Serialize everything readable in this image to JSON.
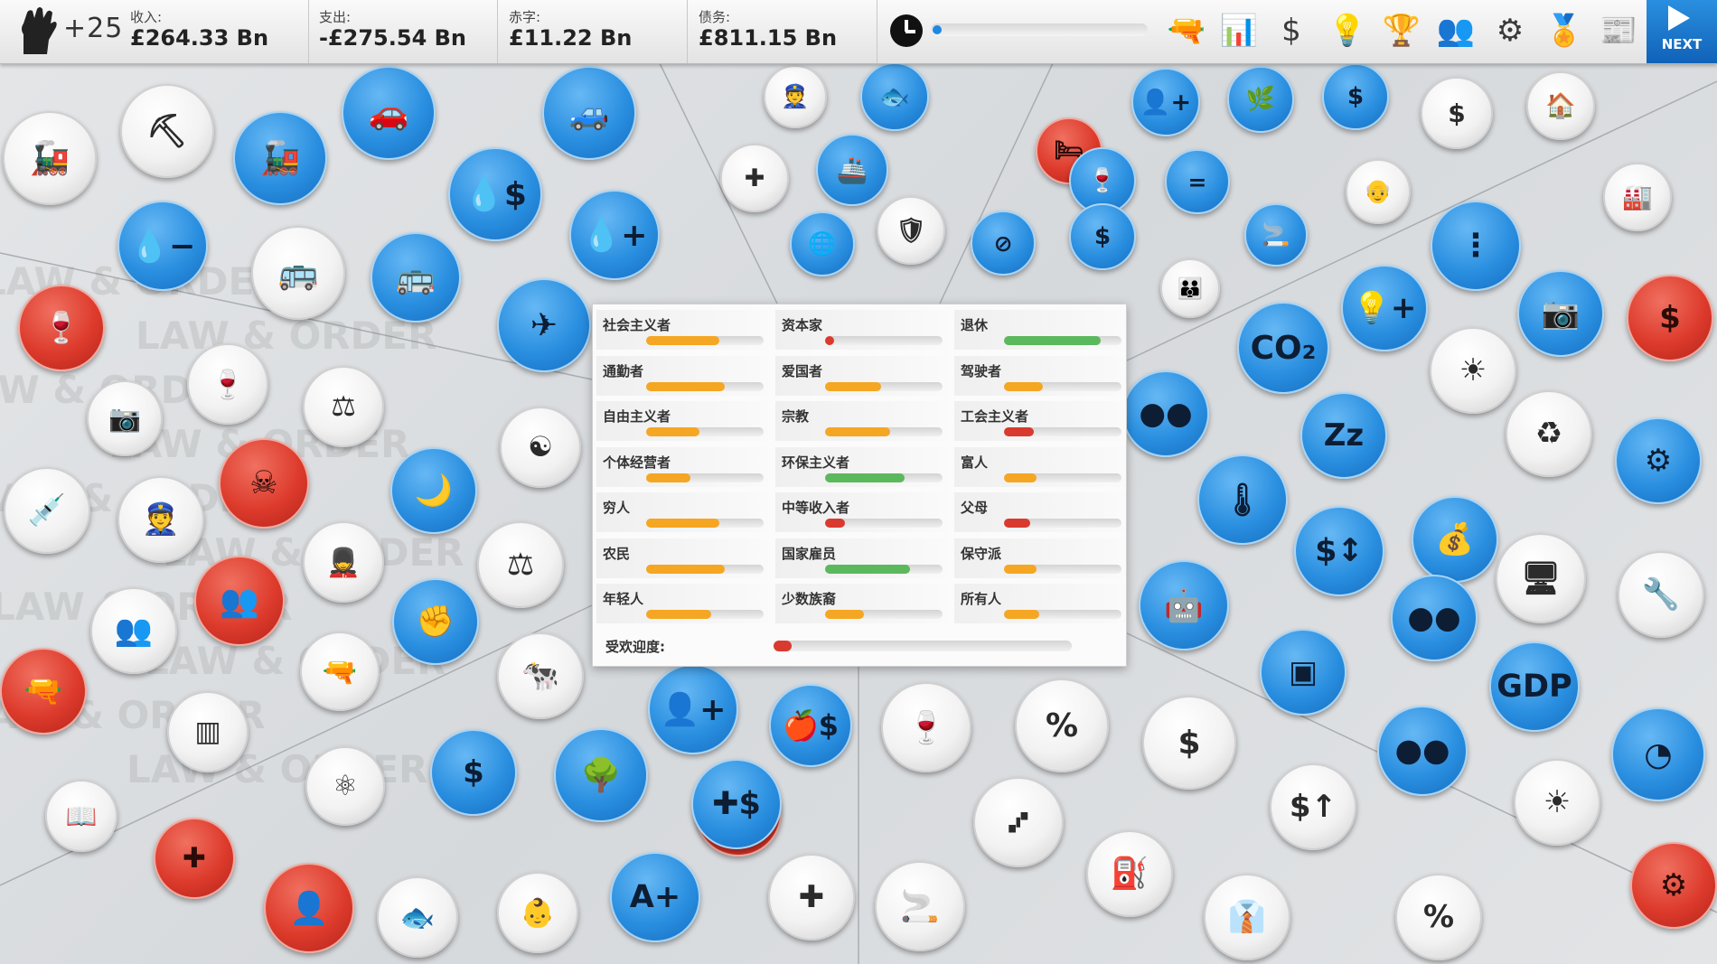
{
  "topbar": {
    "political_capital": "+25",
    "income_label": "收入:",
    "income_value": "£264.33 Bn",
    "expenses_label": "支出:",
    "expenses_value": "-£275.54 Bn",
    "deficit_label": "赤字:",
    "deficit_value": "£11.22 Bn",
    "debt_label": "债务:",
    "debt_value": "£811.15 Bn",
    "turn_progress": 0.02,
    "next_label": "NEXT"
  },
  "toolbar_icons": [
    "gun-icon",
    "bar-chart-icon",
    "dollar-icon",
    "lightbulb-icon",
    "trophy-icon",
    "people-icon",
    "gears-icon",
    "medal-icon",
    "newspaper-icon"
  ],
  "background_text": "LAW & ORDER",
  "voters": {
    "col1": [
      {
        "label": "社会主义者",
        "value": 0.62,
        "color": "#f5a623"
      },
      {
        "label": "通勤者",
        "value": 0.67,
        "color": "#f5a623"
      },
      {
        "label": "自由主义者",
        "value": 0.45,
        "color": "#f5a623"
      },
      {
        "label": "个体经营者",
        "value": 0.38,
        "color": "#f5a623"
      },
      {
        "label": "穷人",
        "value": 0.62,
        "color": "#f5a623"
      },
      {
        "label": "农民",
        "value": 0.67,
        "color": "#f5a623"
      },
      {
        "label": "年轻人",
        "value": 0.55,
        "color": "#f5a623"
      }
    ],
    "col2": [
      {
        "label": "资本家",
        "value": 0.08,
        "color": "#d93a2f"
      },
      {
        "label": "爱国者",
        "value": 0.48,
        "color": "#f5a623"
      },
      {
        "label": "宗教",
        "value": 0.55,
        "color": "#f5a623"
      },
      {
        "label": "环保主义者",
        "value": 0.68,
        "color": "#5cb85c"
      },
      {
        "label": "中等收入者",
        "value": 0.17,
        "color": "#d93a2f"
      },
      {
        "label": "国家雇员",
        "value": 0.72,
        "color": "#5cb85c"
      },
      {
        "label": "少数族裔",
        "value": 0.33,
        "color": "#f5a623"
      }
    ],
    "col3": [
      {
        "label": "退休",
        "value": 0.82,
        "color": "#5cb85c"
      },
      {
        "label": "驾驶者",
        "value": 0.33,
        "color": "#f5a623"
      },
      {
        "label": "工会主义者",
        "value": 0.25,
        "color": "#d93a2f"
      },
      {
        "label": "富人",
        "value": 0.28,
        "color": "#f5a623"
      },
      {
        "label": "父母",
        "value": 0.22,
        "color": "#d93a2f"
      },
      {
        "label": "保守派",
        "value": 0.28,
        "color": "#f5a623"
      },
      {
        "label": "所有人",
        "value": 0.3,
        "color": "#f5a623"
      }
    ],
    "popularity_label": "受欢迎度:",
    "popularity_value": 0.06
  },
  "policy_icons": [
    {
      "name": "rail-subsidies-icon",
      "style": "w",
      "glyph": "🚂"
    },
    {
      "name": "road-building-icon",
      "style": "w",
      "glyph": "⛏"
    },
    {
      "name": "rail-network-icon",
      "style": "b",
      "glyph": "🚂"
    },
    {
      "name": "car-tax-icon",
      "style": "b",
      "glyph": "🚗"
    },
    {
      "name": "car-emissions-icon",
      "style": "b",
      "glyph": "🚙"
    },
    {
      "name": "petrol-tax-icon",
      "style": "b",
      "glyph": "💧$"
    },
    {
      "name": "water-decrease-icon",
      "style": "b",
      "glyph": "💧−"
    },
    {
      "name": "bus-lanes-icon",
      "style": "w",
      "glyph": "🚌"
    },
    {
      "name": "bus-subsidies-icon",
      "style": "b",
      "glyph": "🚌"
    },
    {
      "name": "fuel-increase-icon",
      "style": "b",
      "glyph": "💧+"
    },
    {
      "name": "airport-icon",
      "style": "b",
      "glyph": "✈"
    },
    {
      "name": "alcohol-law-icon",
      "style": "r",
      "glyph": "🍷"
    },
    {
      "name": "cctv-icon",
      "style": "w",
      "glyph": "📷"
    },
    {
      "name": "drinks-icon",
      "style": "w",
      "glyph": "🍷"
    },
    {
      "name": "judge-gavel-icon",
      "style": "w",
      "glyph": "⚖"
    },
    {
      "name": "yin-yang-icon",
      "style": "w",
      "glyph": "☯"
    },
    {
      "name": "syringe-icon",
      "style": "w",
      "glyph": "💉"
    },
    {
      "name": "police-icon",
      "style": "w",
      "glyph": "👮"
    },
    {
      "name": "death-penalty-icon",
      "style": "r",
      "glyph": "☠"
    },
    {
      "name": "curfew-icon",
      "style": "b",
      "glyph": "🌙"
    },
    {
      "name": "guard-icon",
      "style": "w",
      "glyph": "💂"
    },
    {
      "name": "jury-icon",
      "style": "w",
      "glyph": "⚖"
    },
    {
      "name": "militia-icon",
      "style": "w",
      "glyph": "👥"
    },
    {
      "name": "crowd-icon",
      "style": "r",
      "glyph": "👥"
    },
    {
      "name": "handgun-icon",
      "style": "w",
      "glyph": "🔫"
    },
    {
      "name": "fist-icon",
      "style": "b",
      "glyph": "✊"
    },
    {
      "name": "livestock-icon",
      "style": "w",
      "glyph": "🐄"
    },
    {
      "name": "rifle-icon",
      "style": "r",
      "glyph": "🔫"
    },
    {
      "name": "prison-icon",
      "style": "w",
      "glyph": "▥"
    },
    {
      "name": "atom-icon",
      "style": "w",
      "glyph": "⚛"
    },
    {
      "name": "benefits-icon",
      "style": "b",
      "glyph": "$"
    },
    {
      "name": "forest-icon",
      "style": "b",
      "glyph": "🌳"
    },
    {
      "name": "immigration-icon",
      "style": "b",
      "glyph": "👤+"
    },
    {
      "name": "food-stamp-icon",
      "style": "b",
      "glyph": "🍎$"
    },
    {
      "name": "religion-house-icon",
      "style": "r",
      "glyph": "☯"
    },
    {
      "name": "library-icon",
      "style": "w",
      "glyph": "📖"
    },
    {
      "name": "healthcare-icon",
      "style": "r",
      "glyph": "✚"
    },
    {
      "name": "organ-icon",
      "style": "r",
      "glyph": "👤"
    },
    {
      "name": "fish-icon",
      "style": "w",
      "glyph": "🐟"
    },
    {
      "name": "child-law-icon",
      "style": "w",
      "glyph": "👶"
    },
    {
      "name": "school-grade-icon",
      "style": "b",
      "glyph": "A+"
    },
    {
      "name": "health-subsidy-icon",
      "style": "b",
      "glyph": "✚$"
    },
    {
      "name": "clinic-icon",
      "style": "w",
      "glyph": "✚"
    },
    {
      "name": "police-radio-icon",
      "style": "w",
      "glyph": "👮"
    },
    {
      "name": "trade-icon",
      "style": "b",
      "glyph": "🐟"
    },
    {
      "name": "aid-icon",
      "style": "w",
      "glyph": "✚"
    },
    {
      "name": "shipping-icon",
      "style": "b",
      "glyph": "🚢"
    },
    {
      "name": "globe-icon",
      "style": "b",
      "glyph": "🌐"
    },
    {
      "name": "tank-icon",
      "style": "w",
      "glyph": "🛡"
    },
    {
      "name": "emigration-icon",
      "style": "b",
      "glyph": "👤+"
    },
    {
      "name": "cannabis-icon",
      "style": "b",
      "glyph": "🌿"
    },
    {
      "name": "wage-icon",
      "style": "b",
      "glyph": "$"
    },
    {
      "name": "family-money-icon",
      "style": "w",
      "glyph": "$"
    },
    {
      "name": "housing-icon",
      "style": "w",
      "glyph": "🏠"
    },
    {
      "name": "unemployment-icon",
      "style": "r",
      "glyph": "🛏"
    },
    {
      "name": "equality-icon",
      "style": "b",
      "glyph": "="
    },
    {
      "name": "alcohol-tax-icon",
      "style": "b",
      "glyph": "🍷"
    },
    {
      "name": "elderly-icon",
      "style": "w",
      "glyph": "👴"
    },
    {
      "name": "factory-icon",
      "style": "w",
      "glyph": "🏭"
    },
    {
      "name": "no-money-icon",
      "style": "b",
      "glyph": "⊘"
    },
    {
      "name": "property-tax-icon",
      "style": "b",
      "glyph": "$"
    },
    {
      "name": "smoking-icon",
      "style": "b",
      "glyph": "🚬"
    },
    {
      "name": "family-icon",
      "style": "w",
      "glyph": "👪"
    },
    {
      "name": "bureaucracy-icon",
      "style": "b",
      "glyph": "⋮"
    },
    {
      "name": "co2-icon",
      "style": "b",
      "glyph": "CO₂"
    },
    {
      "name": "innovation-icon",
      "style": "b",
      "glyph": "💡+"
    },
    {
      "name": "camera-icon",
      "style": "b",
      "glyph": "📷"
    },
    {
      "name": "foreign-tax-icon",
      "style": "r",
      "glyph": "$"
    },
    {
      "name": "coins-icon",
      "style": "b",
      "glyph": "●●"
    },
    {
      "name": "sleep-icon",
      "style": "b",
      "glyph": "Zz"
    },
    {
      "name": "sunrise-icon",
      "style": "w",
      "glyph": "☀"
    },
    {
      "name": "recycle-icon",
      "style": "w",
      "glyph": "♻"
    },
    {
      "name": "technology-icon",
      "style": "b",
      "glyph": "⚙"
    },
    {
      "name": "thermometer-icon",
      "style": "b",
      "glyph": "🌡"
    },
    {
      "name": "dollar-updown-icon",
      "style": "b",
      "glyph": "$↕"
    },
    {
      "name": "wealth-icon",
      "style": "b",
      "glyph": "💰"
    },
    {
      "name": "computer-icon",
      "style": "w",
      "glyph": "🖥"
    },
    {
      "name": "tools-icon",
      "style": "w",
      "glyph": "🔧"
    },
    {
      "name": "robot-arm-icon",
      "style": "b",
      "glyph": "🤖"
    },
    {
      "name": "safe-icon",
      "style": "b",
      "glyph": "▣"
    },
    {
      "name": "coin-stack-icon",
      "style": "b",
      "glyph": "●●"
    },
    {
      "name": "gdp-icon",
      "style": "b",
      "glyph": "GDP"
    },
    {
      "name": "wine-icon",
      "style": "w",
      "glyph": "🍷"
    },
    {
      "name": "percent-icon",
      "style": "w",
      "glyph": "%"
    },
    {
      "name": "house-dollar-icon",
      "style": "w",
      "glyph": "$"
    },
    {
      "name": "coins-up-icon",
      "style": "w",
      "glyph": "$↑"
    },
    {
      "name": "deposit-icon",
      "style": "b",
      "glyph": "●●"
    },
    {
      "name": "renewable-icon",
      "style": "w",
      "glyph": "☀"
    },
    {
      "name": "pie-person-icon",
      "style": "b",
      "glyph": "◔"
    },
    {
      "name": "hierarchy-icon",
      "style": "w",
      "glyph": "⑇"
    },
    {
      "name": "fuel-nozzle-icon",
      "style": "w",
      "glyph": "⛽"
    },
    {
      "name": "tobacco-icon",
      "style": "w",
      "glyph": "🚬"
    },
    {
      "name": "suit-icon",
      "style": "w",
      "glyph": "👔"
    },
    {
      "name": "sales-tax-icon",
      "style": "w",
      "glyph": "%"
    },
    {
      "name": "industry-gears-icon",
      "style": "r",
      "glyph": "⚙"
    }
  ]
}
